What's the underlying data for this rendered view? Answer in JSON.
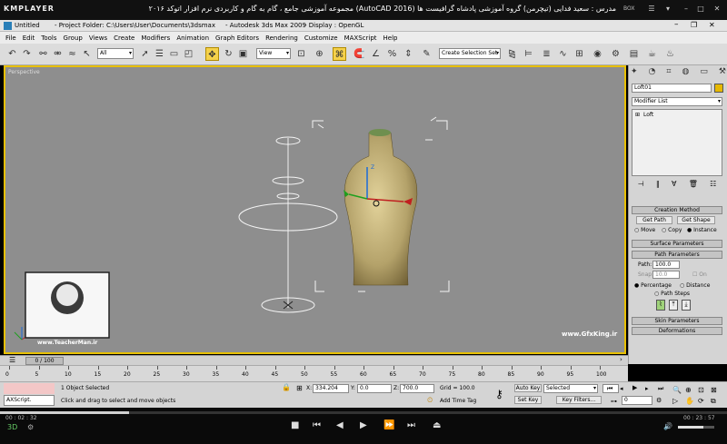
{
  "player": {
    "logo": "KMPLAYER",
    "title": "مجموعه آموزشی جامع ، گام به گام و کاربردی نرم افزار اتوکد ۲۰۱۶ (AutoCAD 2016) مدرس : سعید فدایی (تیچرمن) گروه آموزشی پادشاه گرافیست ها",
    "box_label": "BOX",
    "time_elapsed": "00 : 02 : 32",
    "time_total": "00 : 23 : 57",
    "progress": 0.177
  },
  "max": {
    "untitled": "Untitled",
    "project_folder": "- Project Folder: C:\\Users\\User\\Documents\\3dsmax",
    "app_title": "- Autodesk 3ds Max  2009",
    "display": "- Display : OpenGL"
  },
  "menu": [
    "File",
    "Edit",
    "Tools",
    "Group",
    "Views",
    "Create",
    "Modifiers",
    "Animation",
    "Graph Editors",
    "Rendering",
    "Customize",
    "MAXScript",
    "Help"
  ],
  "toolbar": {
    "filter": "All",
    "ref_coord": "View",
    "selection_set": "Create Selection Set"
  },
  "viewport": {
    "label": "Perspective",
    "watermark_url": "www.TeacherMan.ir",
    "watermark_site": "www.GfxKing.ir"
  },
  "panel": {
    "object_name": "Loft01",
    "modifier_list": "Modifier List",
    "stack_item": "Loft",
    "creation_method": "Creation Method",
    "get_path": "Get Path",
    "get_shape": "Get Shape",
    "move": "Move",
    "copy": "Copy",
    "instance": "Instance",
    "surface_params": "Surface Parameters",
    "path_params": "Path Parameters",
    "path_label": "Path:",
    "path_value": "100.0",
    "snap_label": "Snap:",
    "snap_value": "10.0",
    "on_label": "On",
    "percentage": "Percentage",
    "distance": "Distance",
    "path_steps": "Path Steps",
    "skin_params": "Skin Parameters",
    "deformations": "Deformations"
  },
  "timeline": {
    "frame_counter": "0 / 100",
    "ticks": [
      "0",
      "5",
      "10",
      "15",
      "20",
      "25",
      "30",
      "35",
      "40",
      "45",
      "50",
      "55",
      "60",
      "65",
      "70",
      "75",
      "80",
      "85",
      "90",
      "95",
      "100"
    ]
  },
  "status": {
    "script_label": "AXScript.",
    "selection": "1 Object Selected",
    "prompt": "Click and drag to select and move objects",
    "x_label": "X:",
    "x_value": "334.204",
    "y_label": "Y:",
    "y_value": "0.0",
    "z_label": "Z:",
    "z_value": "700.0",
    "grid": "Grid = 100.0",
    "add_time_tag": "Add Time Tag",
    "auto_key": "Auto Key",
    "set_key": "Set Key",
    "key_mode": "Selected",
    "key_filters": "Key Filters...",
    "current_frame": "0"
  }
}
